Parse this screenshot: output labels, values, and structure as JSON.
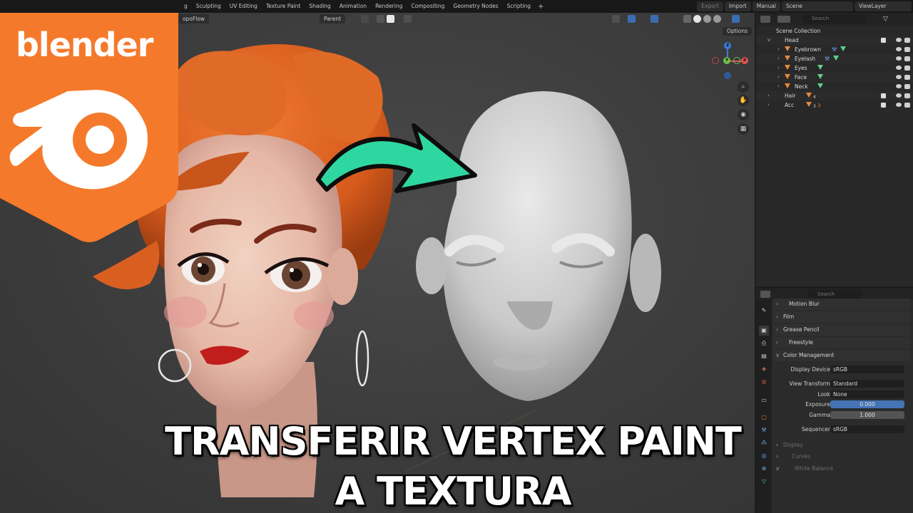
{
  "topbar": {
    "workspace_tabs": [
      "g",
      "Sculpting",
      "UV Editing",
      "Texture Paint",
      "Shading",
      "Animation",
      "Rendering",
      "Compositing",
      "Geometry Nodes",
      "Scripting"
    ],
    "add_tab": "+",
    "export_label": "Export",
    "import_label": "Import",
    "manual_label": "Manual",
    "scene_label": "Scene",
    "viewlayer_label": "ViewLayer"
  },
  "viewport": {
    "topoflow_label": "opoFlow",
    "parent_label": "Parent",
    "options_label": "Options"
  },
  "logo": {
    "text": "blender",
    "brand_color": "#f5792a"
  },
  "overlay_title": {
    "line1": "TRANSFERIR VERTEX PAINT",
    "line2": "A TEXTURA",
    "arrow_color": "#2fd7a0"
  },
  "outliner": {
    "search_placeholder": "Search",
    "root": "Scene Collection",
    "items": [
      {
        "label": "Head",
        "level": 0,
        "expanded": true
      },
      {
        "label": "Eyebrown",
        "level": 1
      },
      {
        "label": "Eyelash",
        "level": 1
      },
      {
        "label": "Eyes",
        "level": 1
      },
      {
        "label": "Face",
        "level": 1
      },
      {
        "label": "Neck",
        "level": 1
      },
      {
        "label": "Hair",
        "level": 0,
        "badge": "4"
      },
      {
        "label": "Acc",
        "level": 0,
        "badge": "3"
      }
    ]
  },
  "properties": {
    "search_placeholder": "Search",
    "sections": {
      "motion_blur": "Motion Blur",
      "film": "Film",
      "grease_pencil": "Grease Pencil",
      "freestyle": "Freestyle",
      "color_management": "Color Management",
      "display": "Display",
      "curves": "Curves",
      "white_balance": "White Balance"
    },
    "fields": {
      "display_device_label": "Display Device",
      "display_device_value": "sRGB",
      "view_transform_label": "View Transform",
      "view_transform_value": "Standard",
      "look_label": "Look",
      "look_value": "None",
      "exposure_label": "Exposure",
      "exposure_value": "0.000",
      "gamma_label": "Gamma",
      "gamma_value": "1.000",
      "gamma_fill": 0.18,
      "sequencer_label": "Sequencer",
      "sequencer_value": "sRGB"
    }
  }
}
